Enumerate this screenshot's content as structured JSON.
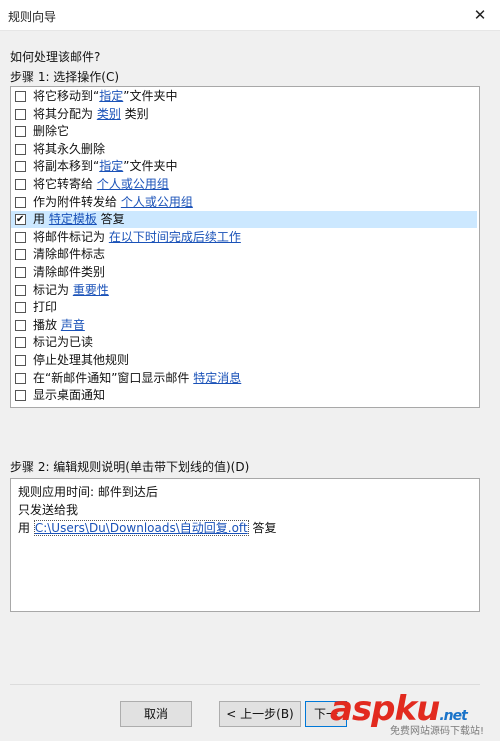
{
  "window": {
    "title": "规则向导",
    "close_label": "✕"
  },
  "question": "如何处理该邮件?",
  "step1_label": "步骤 1: 选择操作(C)",
  "actions": [
    {
      "text": "将它移动到“",
      "link": "指定",
      "after": "”文件夹中",
      "checked": false,
      "selected": false
    },
    {
      "text": "将其分配为 ",
      "link": "类别",
      "after": " 类别",
      "checked": false,
      "selected": false
    },
    {
      "text": "删除它",
      "link": "",
      "after": "",
      "checked": false,
      "selected": false
    },
    {
      "text": "将其永久删除",
      "link": "",
      "after": "",
      "checked": false,
      "selected": false
    },
    {
      "text": "将副本移到“",
      "link": "指定",
      "after": "”文件夹中",
      "checked": false,
      "selected": false
    },
    {
      "text": "将它转寄给 ",
      "link": "个人或公用组",
      "after": "",
      "checked": false,
      "selected": false
    },
    {
      "text": "作为附件转发给 ",
      "link": "个人或公用组",
      "after": "",
      "checked": false,
      "selected": false
    },
    {
      "text": "用 ",
      "link": "特定模板",
      "after": " 答复",
      "checked": true,
      "selected": true
    },
    {
      "text": "将邮件标记为 ",
      "link": "在以下时间完成后续工作",
      "after": "",
      "checked": false,
      "selected": false
    },
    {
      "text": "清除邮件标志",
      "link": "",
      "after": "",
      "checked": false,
      "selected": false
    },
    {
      "text": "清除邮件类别",
      "link": "",
      "after": "",
      "checked": false,
      "selected": false
    },
    {
      "text": "标记为 ",
      "link": "重要性",
      "after": "",
      "checked": false,
      "selected": false
    },
    {
      "text": "打印",
      "link": "",
      "after": "",
      "checked": false,
      "selected": false
    },
    {
      "text": "播放 ",
      "link": "声音",
      "after": "",
      "checked": false,
      "selected": false
    },
    {
      "text": "标记为已读",
      "link": "",
      "after": "",
      "checked": false,
      "selected": false
    },
    {
      "text": "停止处理其他规则",
      "link": "",
      "after": "",
      "checked": false,
      "selected": false
    },
    {
      "text": "在“新邮件通知”窗口显示邮件 ",
      "link": "特定消息",
      "after": "",
      "checked": false,
      "selected": false
    },
    {
      "text": "显示桌面通知",
      "link": "",
      "after": "",
      "checked": false,
      "selected": false
    }
  ],
  "step2_label": "步骤 2: 编辑规则说明(单击带下划线的值)(D)",
  "description": {
    "line1": "规则应用时间: 邮件到达后",
    "line2": "只发送给我",
    "line3_prefix": "用 ",
    "line3_link": "C:\\Users\\Du\\Downloads\\自动回复.oft",
    "line3_suffix": " 答复"
  },
  "buttons": {
    "cancel": "取消",
    "back": "< 上一步(B)",
    "next": "下一"
  },
  "watermark": {
    "main": "aspku",
    "tld": ".net",
    "sub": "免费网站源码下载站!"
  }
}
